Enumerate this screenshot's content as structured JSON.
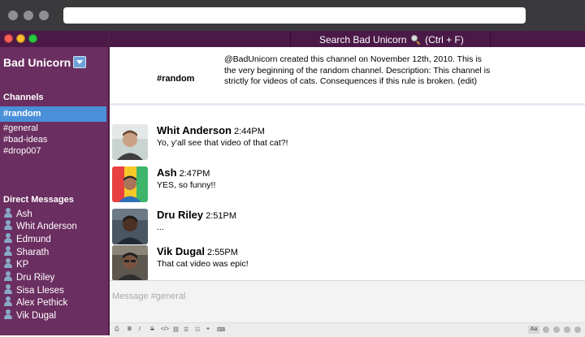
{
  "search": {
    "label": "Search Bad Unicorn",
    "shortcut": "(Ctrl + F)"
  },
  "team": {
    "name": "Bad Unicorn"
  },
  "sidebar": {
    "channels_title": "Channels",
    "active_channel": "#random",
    "channels": [
      "#general",
      "#bad-ideas",
      "#drop007"
    ],
    "dm_title": "Direct Messages",
    "dms": [
      "Ash",
      "Whit Anderson",
      "Edmund",
      "Sharath",
      "KP",
      "Dru Riley",
      "Sisa Lleses",
      "Alex Pethick",
      "Vik Dugal"
    ]
  },
  "channel_info": {
    "name": "#random",
    "description": "@BadUnicorn created this channel on November 12th, 2010. This is the very beginning of the random channel. Description: This channel is strictly for videos of cats. Consequences if this rule is broken. (edit)"
  },
  "messages": [
    {
      "author": "Whit Anderson",
      "time": "2:44PM",
      "text": "Yo, y'all see that video of that cat?!"
    },
    {
      "author": "Ash",
      "time": "2:47PM",
      "text": "YES, so funny!!"
    },
    {
      "author": "Dru Riley",
      "time": "2:51PM",
      "text": "..."
    },
    {
      "author": "Vik Dugal",
      "time": "2:55PM",
      "text": "That cat video was epic!"
    }
  ],
  "composer": {
    "placeholder": "Message #general",
    "toolbar_left": [
      "B",
      "I",
      "S",
      "</>",
      "link",
      "ul",
      "ol",
      "quote",
      "code"
    ],
    "toolbar_right_label": "Aa"
  },
  "colors": {
    "sidebar": "#6b2e60",
    "topbar": "#4b1948",
    "active_channel": "#4a90d9",
    "browser_chrome": "#3a3a3c"
  }
}
